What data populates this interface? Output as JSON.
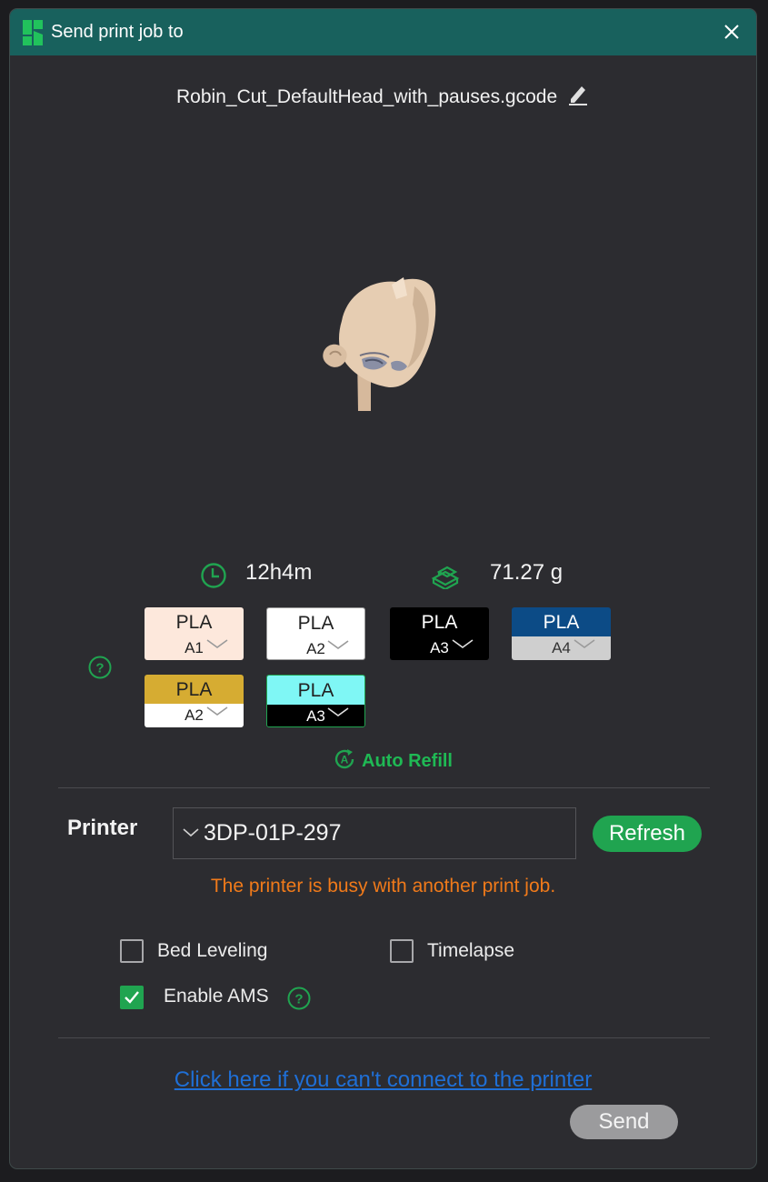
{
  "dialog": {
    "title": "Send print job to",
    "filename": "Robin_Cut_DefaultHead_with_pauses.gcode"
  },
  "stats": {
    "time": "12h4m",
    "weight": "71.27 g"
  },
  "materials": [
    {
      "type": "PLA",
      "slot": "A1",
      "top_color": "#fde8dc",
      "bottom_color": "#fde8dc",
      "text_color": "#222222",
      "slot_text_color": "#222222"
    },
    {
      "type": "PLA",
      "slot": "A2",
      "top_color": "#ffffff",
      "bottom_color": "#ffffff",
      "text_color": "#222222",
      "slot_text_color": "#222222"
    },
    {
      "type": "PLA",
      "slot": "A3",
      "top_color": "#000000",
      "bottom_color": "#000000",
      "text_color": "#ffffff",
      "slot_text_color": "#ffffff"
    },
    {
      "type": "PLA",
      "slot": "A4",
      "top_color": "#0c4b86",
      "bottom_color": "#cfcfcf",
      "text_color": "#ffffff",
      "slot_text_color": "#333333"
    },
    {
      "type": "PLA",
      "slot": "A2",
      "top_color": "#d6ac32",
      "bottom_color": "#ffffff",
      "text_color": "#222222",
      "slot_text_color": "#222222"
    },
    {
      "type": "PLA",
      "slot": "A3",
      "top_color": "#7ff7f5",
      "bottom_color": "#000000",
      "text_color": "#222222",
      "slot_text_color": "#ffffff"
    }
  ],
  "auto_refill": "Auto Refill",
  "printer": {
    "label": "Printer",
    "selected": "3DP-01P-297",
    "refresh_label": "Refresh",
    "status": "The printer is busy with another print job."
  },
  "options": {
    "bed_leveling": {
      "label": "Bed Leveling",
      "checked": false
    },
    "timelapse": {
      "label": "Timelapse",
      "checked": false
    },
    "enable_ams": {
      "label": "Enable AMS",
      "checked": true
    }
  },
  "help_link": "Click here if you can't connect to the printer",
  "send_label": "Send",
  "colors": {
    "titlebar": "#18615d",
    "accent_green": "#20a450",
    "warning_orange": "#f07a1a",
    "link_blue": "#1f6fd6"
  }
}
